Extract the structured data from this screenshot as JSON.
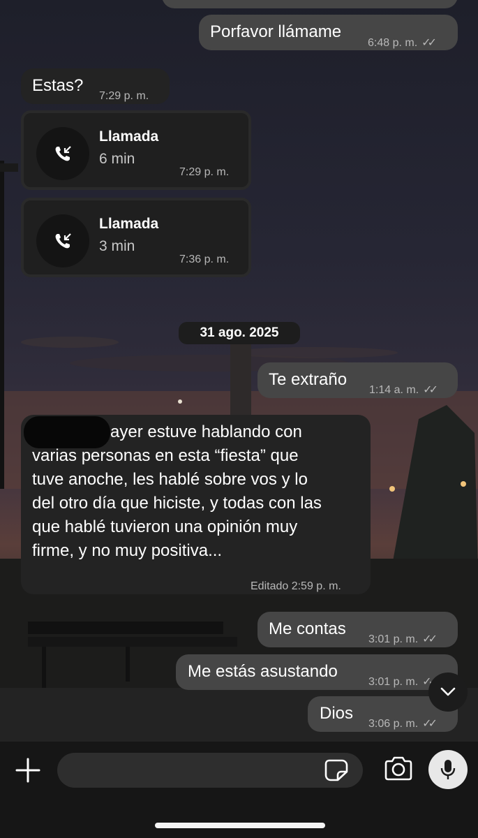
{
  "messages": {
    "m1": {
      "text": "Porfavor llámame",
      "time": "6:48 p. m.",
      "ticks": "✓✓"
    },
    "m2": {
      "text": "Estas?",
      "time": "7:29 p. m."
    },
    "call1": {
      "title": "Llamada",
      "duration": "6 min",
      "time": "7:29 p. m."
    },
    "call2": {
      "title": "Llamada",
      "duration": "3 min",
      "time": "7:36 p. m."
    },
    "date": "31 ago. 2025",
    "m3": {
      "text": "Te extraño",
      "time": "1:14 a. m.",
      "ticks": "✓✓"
    },
    "m4": {
      "line1": "ayer estuve hablando con",
      "line2": "varias personas en esta “fiesta” que",
      "line3": "tuve anoche, les hablé sobre vos y lo",
      "line4": "del otro día que hiciste, y todas con las",
      "line5": "que hablé tuvieron una opinión muy",
      "line6": "firme, y no muy positiva...",
      "meta": "Editado 2:59 p. m."
    },
    "m5": {
      "text": "Me contas",
      "time": "3:01 p. m.",
      "ticks": "✓✓"
    },
    "m6": {
      "text": "Me estás asustando",
      "time": "3:01 p. m.",
      "ticks": "✓✓"
    },
    "m7": {
      "text": "Dios",
      "time": "3:06 p. m.",
      "ticks": "✓✓"
    }
  },
  "icons": {
    "call": "incoming-call-icon",
    "scroll": "chevron-down-icon",
    "add": "plus-icon",
    "sticker": "sticker-icon",
    "camera": "camera-icon",
    "mic": "microphone-icon"
  },
  "colors": {
    "outgoing_bubble": "#464646",
    "incoming_bubble": "#232323",
    "input_bar": "#161616"
  }
}
